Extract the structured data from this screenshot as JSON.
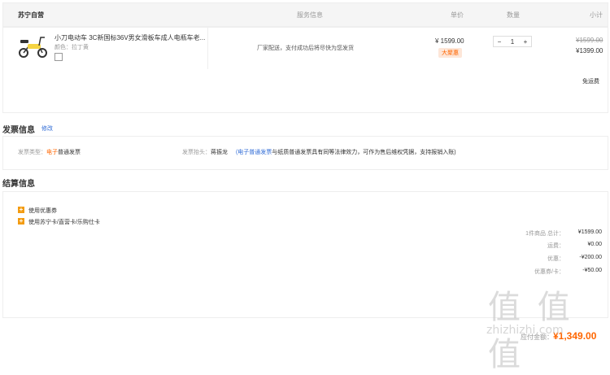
{
  "header": {
    "store": "苏宁自营",
    "service": "服务信息",
    "price": "单价",
    "quantity": "数量",
    "subtotal": "小计"
  },
  "product": {
    "title": "小刀电动车 3C新国标36V男女滑板车成人电瓶车老...",
    "color_label": "颜色：拉丁黄",
    "service_text": "厂家配送，支付成功后将尽快为您发货",
    "price": "¥ 1599.00",
    "tag": "大聚惠",
    "qty_minus": "−",
    "qty_value": "1",
    "qty_plus": "+",
    "subtotal_original": "¥1599.00",
    "subtotal_final": "¥1399.00"
  },
  "shipping": "免运费",
  "invoice": {
    "section_title": "发票信息",
    "edit_link": "修改",
    "type_label": "发票类型：",
    "type_value_1": "电子",
    "type_value_2": "普通发票",
    "head_label": "发票抬头：",
    "head_value": "蒋振龙",
    "note_link": "(电子普通发票",
    "note_text": "与纸质普通发票具有同等法律效力，可作为售后维权凭据，支持报销入账)"
  },
  "settlement": {
    "section_title": "结算信息",
    "coupon_label": "使用优惠券",
    "card_label": "使用苏宁卡/直营卡/乐购仕卡",
    "rows": [
      {
        "label": "1件商品 总计：",
        "value": "¥1599.00"
      },
      {
        "label": "运费：",
        "value": "¥0.00"
      },
      {
        "label": "优惠：",
        "value": "-¥200.00"
      },
      {
        "label": "优惠券/卡：",
        "value": "-¥50.00"
      }
    ],
    "total_label": "应付金额：",
    "total_value": "¥1,349.00"
  },
  "watermark": {
    "big": "值 值 值",
    "site": "zhizhizhi.com"
  },
  "colors": {
    "accent": "#ff6600",
    "link": "#2f6bd6",
    "header_bg": "#f5f5f5"
  }
}
